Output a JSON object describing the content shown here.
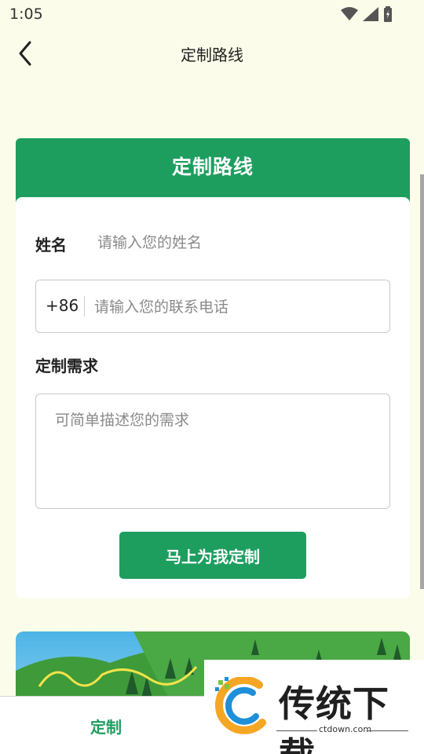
{
  "status_bar": {
    "time": "1:05"
  },
  "nav": {
    "title": "定制路线"
  },
  "form": {
    "title": "定制路线",
    "name_label": "姓名",
    "name_placeholder": "请输入您的姓名",
    "phone_prefix": "+86",
    "phone_placeholder": "请输入您的联系电话",
    "requirement_label": "定制需求",
    "requirement_placeholder": "可简单描述您的需求",
    "submit_label": "马上为我定制"
  },
  "tab_bar": {
    "active_tab_label": "定制"
  },
  "watermark": {
    "name": "传统下载",
    "url": "ctdown.com"
  },
  "colors": {
    "primary": "#1d9e5f",
    "page_bg": "#fbfce9"
  }
}
